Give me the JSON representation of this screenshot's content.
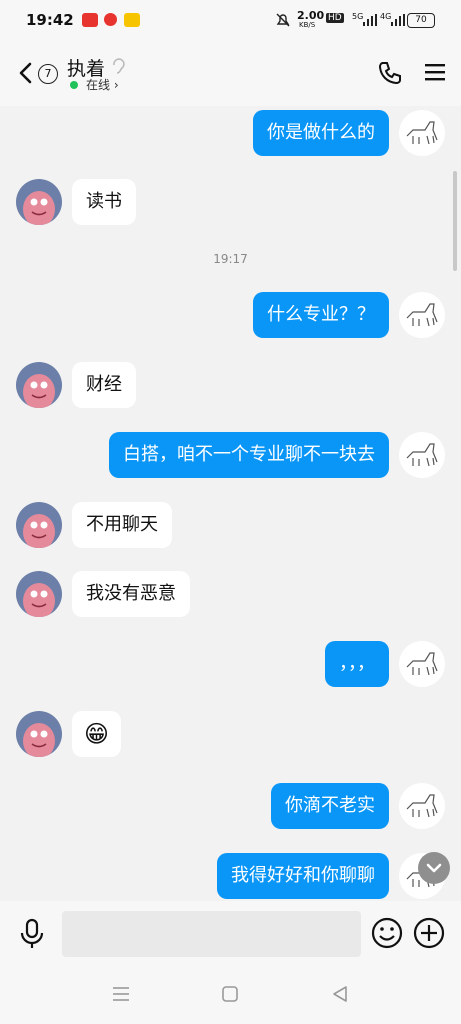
{
  "status_bar": {
    "time": "19:42",
    "net_speed_value": "2.00",
    "net_speed_unit": "KB/S",
    "hd_label": "HD",
    "sim1_label": "5G",
    "sim2_label": "4G",
    "battery": "70"
  },
  "header": {
    "unread_count": "7",
    "contact_name": "执着",
    "online_status": "在线 ›"
  },
  "messages": [
    {
      "side": "right",
      "text": "你是做什么的"
    },
    {
      "side": "left",
      "text": "读书"
    },
    {
      "type": "timestamp",
      "text": "19:17"
    },
    {
      "side": "right",
      "text": "什么专业？？"
    },
    {
      "side": "left",
      "text": "财经"
    },
    {
      "side": "right",
      "text": "白搭，咱不一个专业聊不一块去"
    },
    {
      "side": "left",
      "text": "不用聊天"
    },
    {
      "side": "left",
      "text": "我没有恶意"
    },
    {
      "side": "right",
      "text": "，，，"
    },
    {
      "side": "left",
      "text": "😁"
    },
    {
      "side": "right",
      "text": "你滴不老实"
    },
    {
      "side": "right",
      "text": "我得好好和你聊聊"
    }
  ],
  "input": {
    "placeholder": ""
  },
  "colors": {
    "accent": "#0a96f7",
    "online": "#22c25a",
    "background": "#f2f2f2"
  },
  "icons": [
    "back-arrow-icon",
    "ear-icon",
    "phone-icon",
    "menu-icon",
    "mic-icon",
    "emoji-icon",
    "plus-icon",
    "scroll-down-icon",
    "nav-menu-icon",
    "nav-home-icon",
    "nav-back-icon"
  ]
}
